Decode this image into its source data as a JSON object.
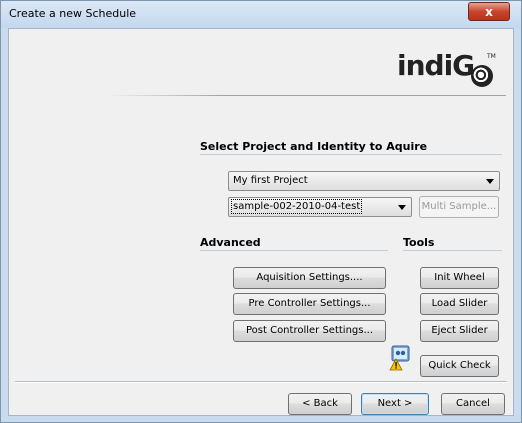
{
  "window": {
    "title": "Create a new Schedule",
    "close_glyph": "x"
  },
  "logo": {
    "text": "indiG",
    "tm": "TM"
  },
  "select_section": {
    "heading": "Select Project and Identity to Aquire",
    "project_value": "My first Project",
    "identity_value": "sample-002-2010-04-test",
    "multi_sample_label": "Multi Sample..."
  },
  "advanced": {
    "heading": "Advanced",
    "acquisition_label": "Aquisition Settings....",
    "pre_controller_label": "Pre Controller Settings...",
    "post_controller_label": "Post Controller Settings..."
  },
  "tools": {
    "heading": "Tools",
    "init_wheel_label": "Init Wheel",
    "load_slider_label": "Load Slider",
    "eject_slider_label": "Eject Slider",
    "quick_check_label": "Quick Check"
  },
  "footer": {
    "back_label": "< Back",
    "next_label": "Next >",
    "cancel_label": "Cancel"
  }
}
